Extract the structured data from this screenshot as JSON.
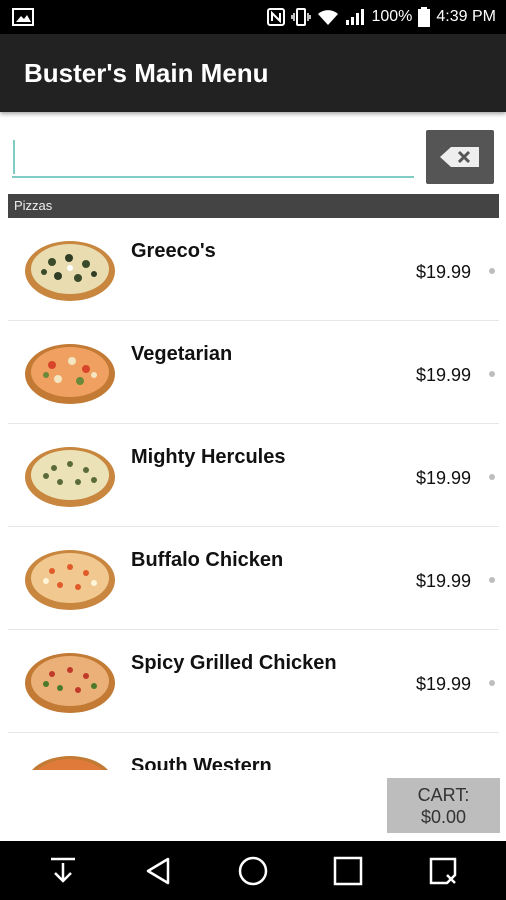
{
  "status_bar": {
    "battery": "100%",
    "time": "4:39 PM",
    "left_icon": "image-icon",
    "right_icons": [
      "nfc-icon",
      "vibrate-icon",
      "wifi-icon",
      "signal-icon",
      "battery-icon"
    ]
  },
  "app_bar": {
    "title": "Buster's Main Menu"
  },
  "search": {
    "value": "",
    "placeholder": "",
    "clear_icon": "backspace-icon"
  },
  "section": {
    "title": "Pizzas"
  },
  "items": [
    {
      "name": "Greeco's",
      "price": "$19.99"
    },
    {
      "name": "Vegetarian",
      "price": "$19.99"
    },
    {
      "name": "Mighty Hercules",
      "price": "$19.99"
    },
    {
      "name": "Buffalo Chicken",
      "price": "$19.99"
    },
    {
      "name": "Spicy Grilled Chicken",
      "price": "$19.99"
    },
    {
      "name": "South Western",
      "price": ""
    }
  ],
  "cart": {
    "label": "CART:",
    "total": "$0.00"
  },
  "nav": {
    "icons": [
      "download-icon",
      "back-icon",
      "home-icon",
      "recents-icon",
      "notes-icon"
    ]
  },
  "colors": {
    "app_bar": "#222222",
    "accent": "#80cbc4",
    "section_header": "#444444",
    "cart_bg": "#bdbdbd"
  }
}
